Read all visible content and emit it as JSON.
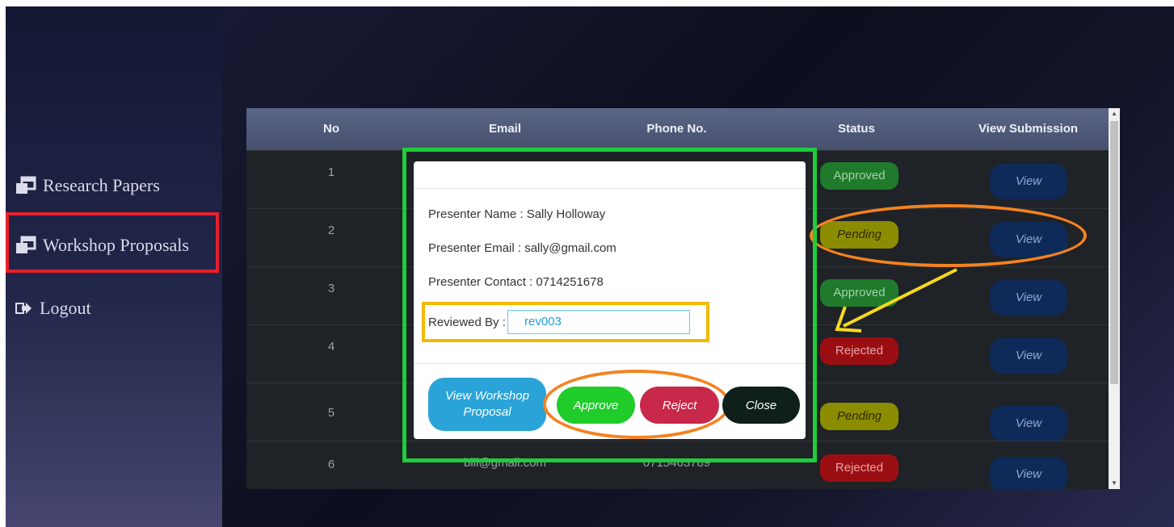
{
  "sidebar": {
    "items": [
      {
        "label": "Research Papers",
        "icon": "clone-icon"
      },
      {
        "label": "Workshop Proposals",
        "icon": "clone-icon"
      },
      {
        "label": "Logout",
        "icon": "sign-out-icon"
      }
    ],
    "active": "Workshop Proposals"
  },
  "table": {
    "headers": [
      "No",
      "Email",
      "Phone No.",
      "Status",
      "View Submission"
    ],
    "rows": [
      {
        "no": "1",
        "status": "Approved",
        "view": "View"
      },
      {
        "no": "2",
        "status": "Pending",
        "view": "View"
      },
      {
        "no": "3",
        "status": "Approved",
        "view": "View"
      },
      {
        "no": "4",
        "status": "Rejected",
        "view": "View"
      },
      {
        "no": "5",
        "status": "Pending",
        "view": "View"
      },
      {
        "no": "6",
        "email": "bill@gmail.com",
        "phone": "0715463789",
        "status": "Rejected",
        "view": "View"
      }
    ]
  },
  "modal": {
    "presenter_name": "Presenter Name : Sally Holloway",
    "presenter_email": "Presenter Email : sally@gmail.com",
    "presenter_contact": "Presenter Contact : 0714251678",
    "reviewed_by_label": "Reviewed By :",
    "reviewed_by_value": "rev003",
    "buttons": {
      "view_proposal_line1": "View Workshop",
      "view_proposal_line2": "Proposal",
      "approve": "Approve",
      "reject": "Reject",
      "close": "Close"
    }
  },
  "colors": {
    "approved": "#1f7a2c",
    "pending": "#8c8c00",
    "rejected": "#9a0e12",
    "view_button": "#0e2a58",
    "approve_button": "#1fcc2a",
    "reject_button": "#c8284a",
    "close_button": "#0f1f1a",
    "view_proposal_button": "#2aa3d8",
    "annotation_green": "#1fcc3c",
    "annotation_orange": "#f5821f",
    "annotation_yellow": "#f5b800",
    "annotation_red": "#e8202b"
  }
}
